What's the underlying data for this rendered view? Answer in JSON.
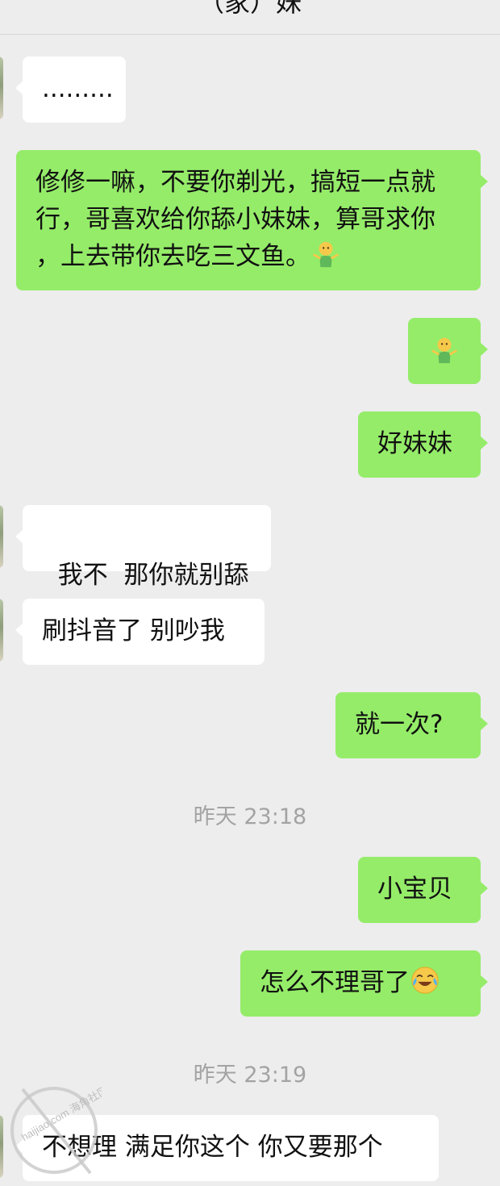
{
  "header": {
    "title": "（家）妹"
  },
  "messages": [
    {
      "id": "m1",
      "direction": "incoming",
      "text": "........."
    },
    {
      "id": "m2",
      "direction": "outgoing",
      "text": "修修一嘛，不要你剃光，搞短一点就行，哥喜欢给你舔小妹妹，算哥求你 ，上去带你去吃三文鱼。",
      "emoji": "shrugging-figure-emoji"
    },
    {
      "id": "m3",
      "direction": "outgoing",
      "text": "",
      "emoji": "shrugging-figure-emoji"
    },
    {
      "id": "m4",
      "direction": "outgoing",
      "text": "好妹妹"
    },
    {
      "id": "m5",
      "direction": "incoming",
      "text": "我不  那你就别舔"
    },
    {
      "id": "m6",
      "direction": "incoming",
      "text": "刷抖音了 别吵我"
    },
    {
      "id": "m7",
      "direction": "outgoing",
      "text": "就一次?"
    },
    {
      "id": "t1",
      "type": "timestamp",
      "text": "昨天 23:18"
    },
    {
      "id": "m8",
      "direction": "outgoing",
      "text": "小宝贝"
    },
    {
      "id": "m9",
      "direction": "outgoing",
      "text": "怎么不理哥了",
      "emoji": "laughing-crying-emoji"
    },
    {
      "id": "t2",
      "type": "timestamp",
      "text": "昨天 23:19"
    },
    {
      "id": "m10",
      "direction": "incoming",
      "text": "不想理 满足你这个 你又要那个"
    }
  ],
  "colors": {
    "background": "#ededed",
    "incoming_bubble": "#ffffff",
    "outgoing_bubble": "#95ec69",
    "timestamp_text": "#a3a3a3"
  },
  "watermark": {
    "text": "haijiao.com 海角社区"
  }
}
